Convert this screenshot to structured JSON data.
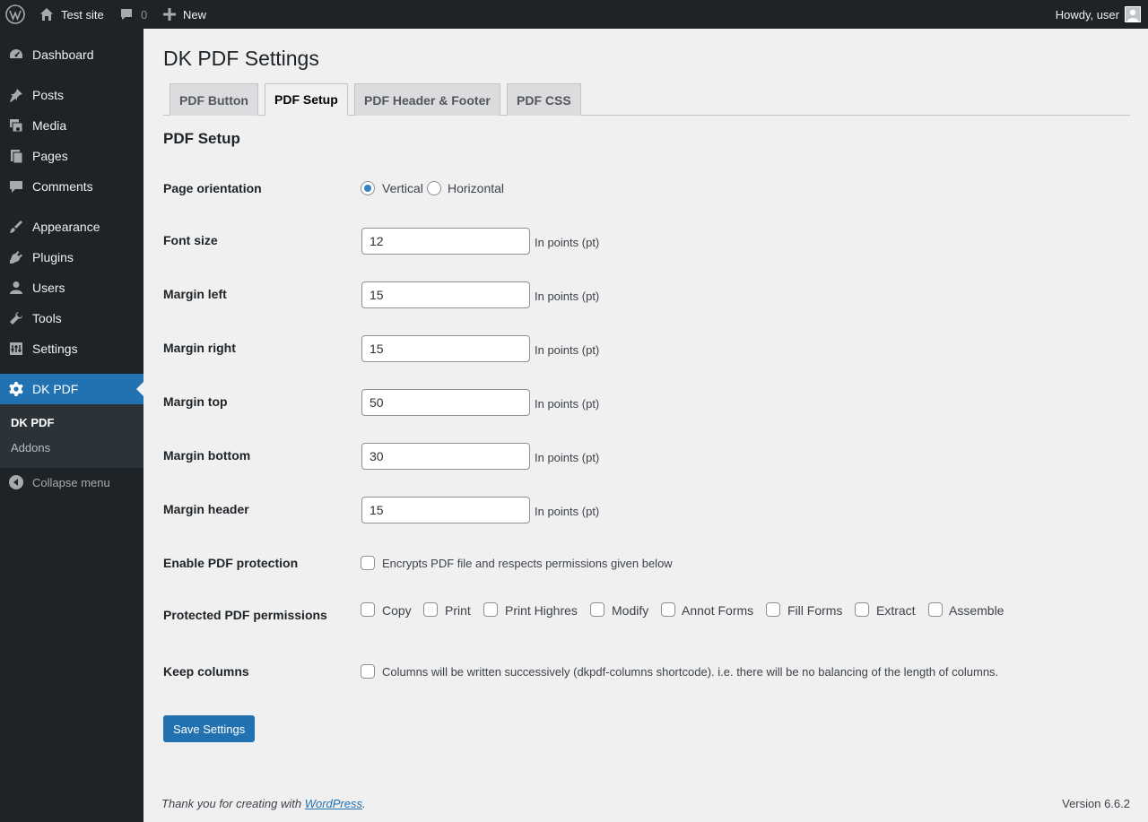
{
  "adminbar": {
    "site_name": "Test site",
    "comments_count": "0",
    "new_label": "New",
    "howdy": "Howdy, user"
  },
  "sidebar": {
    "items": [
      {
        "label": "Dashboard",
        "icon": "dashboard-icon"
      },
      {
        "label": "Posts",
        "icon": "pushpin-icon"
      },
      {
        "label": "Media",
        "icon": "media-icon"
      },
      {
        "label": "Pages",
        "icon": "pages-icon"
      },
      {
        "label": "Comments",
        "icon": "comment-icon"
      },
      {
        "label": "Appearance",
        "icon": "paintbrush-icon"
      },
      {
        "label": "Plugins",
        "icon": "plugin-icon"
      },
      {
        "label": "Users",
        "icon": "user-icon"
      },
      {
        "label": "Tools",
        "icon": "wrench-icon"
      },
      {
        "label": "Settings",
        "icon": "settings-icon"
      },
      {
        "label": "DK PDF",
        "icon": "gear-icon"
      }
    ],
    "submenu": [
      "DK PDF",
      "Addons"
    ],
    "collapse": "Collapse menu"
  },
  "page": {
    "title": "DK PDF Settings",
    "tabs": [
      "PDF Button",
      "PDF Setup",
      "PDF Header & Footer",
      "PDF CSS"
    ],
    "active_tab": "PDF Setup",
    "section_title": "PDF Setup"
  },
  "form": {
    "orientation": {
      "label": "Page orientation",
      "options": [
        "Vertical",
        "Horizontal"
      ],
      "selected": "Vertical"
    },
    "font_size": {
      "label": "Font size",
      "value": "12",
      "hint": "In points (pt)"
    },
    "margin_left": {
      "label": "Margin left",
      "value": "15",
      "hint": "In points (pt)"
    },
    "margin_right": {
      "label": "Margin right",
      "value": "15",
      "hint": "In points (pt)"
    },
    "margin_top": {
      "label": "Margin top",
      "value": "50",
      "hint": "In points (pt)"
    },
    "margin_bottom": {
      "label": "Margin bottom",
      "value": "30",
      "hint": "In points (pt)"
    },
    "margin_header": {
      "label": "Margin header",
      "value": "15",
      "hint": "In points (pt)"
    },
    "protection": {
      "label": "Enable PDF protection",
      "desc": "Encrypts PDF file and respects permissions given below"
    },
    "permissions": {
      "label": "Protected PDF permissions",
      "options": [
        "Copy",
        "Print",
        "Print Highres",
        "Modify",
        "Annot Forms",
        "Fill Forms",
        "Extract",
        "Assemble"
      ]
    },
    "keep_columns": {
      "label": "Keep columns",
      "desc": "Columns will be written successively (dkpdf-columns shortcode). i.e. there will be no balancing of the length of columns."
    },
    "save_label": "Save Settings"
  },
  "footer": {
    "thanks_prefix": "Thank you for creating with ",
    "thanks_link": "WordPress",
    "thanks_suffix": ".",
    "version": "Version 6.6.2"
  },
  "colors": {
    "accent": "#2271b1",
    "adminbar": "#1d2327",
    "background": "#f0f0f1"
  }
}
